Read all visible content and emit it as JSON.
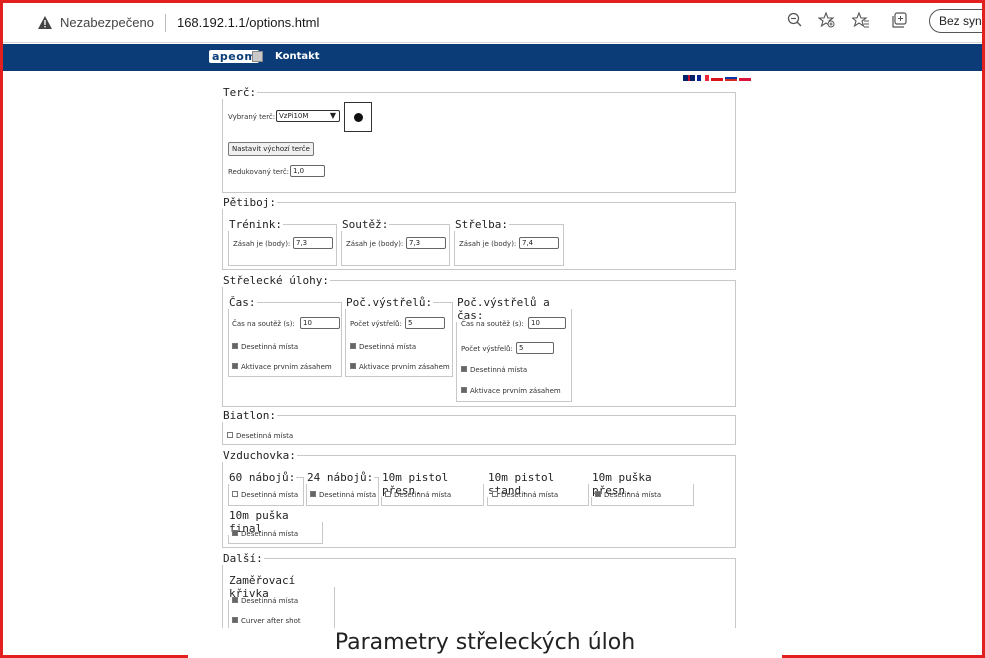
{
  "browser": {
    "security_label": "Nezabezpečeno",
    "url": "168.192.1.1/options.html",
    "sync_label": "Bez synch"
  },
  "nav": {
    "logo": "apeom",
    "contact": "Kontakt"
  },
  "target": {
    "title": "Terč:",
    "selected_label": "Vybraný terč:",
    "selected_value": "VzPi10M",
    "default_button": "Nastavit výchozí terče",
    "reduced_label": "Redukovaný terč:",
    "reduced_value": "1,0"
  },
  "petiboj": {
    "title": "Pětiboj:",
    "groups": [
      {
        "title": "Trénink:",
        "label": "Zásah je (body):",
        "value": "7,3"
      },
      {
        "title": "Soutěž:",
        "label": "Zásah je (body):",
        "value": "7,3"
      },
      {
        "title": "Střelba:",
        "label": "Zásah je (body):",
        "value": "7,4"
      }
    ]
  },
  "tasks": {
    "title": "Střelecké úlohy:",
    "time": {
      "title": "Čas:",
      "label": "Čas na soutěž (s):",
      "value": "10",
      "decimals": "Desetinná místa",
      "activation": "Aktivace prvním zásahem"
    },
    "shots": {
      "title": "Poč.výstřelů:",
      "label": "Počet výstřelů:",
      "value": "5",
      "decimals": "Desetinná místa",
      "activation": "Aktivace prvním zásahem"
    },
    "shots_time": {
      "title": "Poč.výstřelů a čas:",
      "time_label": "Čas na soutěž (s):",
      "time_value": "10",
      "shots_label": "Počet výstřelů:",
      "shots_value": "5",
      "decimals": "Desetinná místa",
      "activation": "Aktivace prvním zásahem"
    }
  },
  "biatlon": {
    "title": "Biatlon:",
    "decimals": "Desetinná místa"
  },
  "air": {
    "title": "Vzduchovka:",
    "groups": [
      {
        "title": "60 nábojů:",
        "decimals": "Desetinná místa",
        "checked": false
      },
      {
        "title": "24 nábojů:",
        "decimals": "Desetinná místa",
        "checked": true
      },
      {
        "title": "10m pistol přesn.",
        "decimals": "Desetinná místa",
        "checked": false
      },
      {
        "title": "10m pistol stand.",
        "decimals": "Desetinná místa",
        "checked": false
      },
      {
        "title": "10m puška přesn.",
        "decimals": "Desetinná místa",
        "checked": true
      },
      {
        "title": "10m puška final",
        "decimals": "Desetinná místa",
        "checked": true
      }
    ]
  },
  "other": {
    "title": "Další:",
    "curve": {
      "title": "Zaměřovací křivka",
      "decimals": "Desetinná místa",
      "curver": "Curver after shot"
    }
  },
  "caption": "Parametry střeleckých úloh",
  "colors": {
    "frame": "#e32020",
    "nav": "#0b3c78"
  }
}
